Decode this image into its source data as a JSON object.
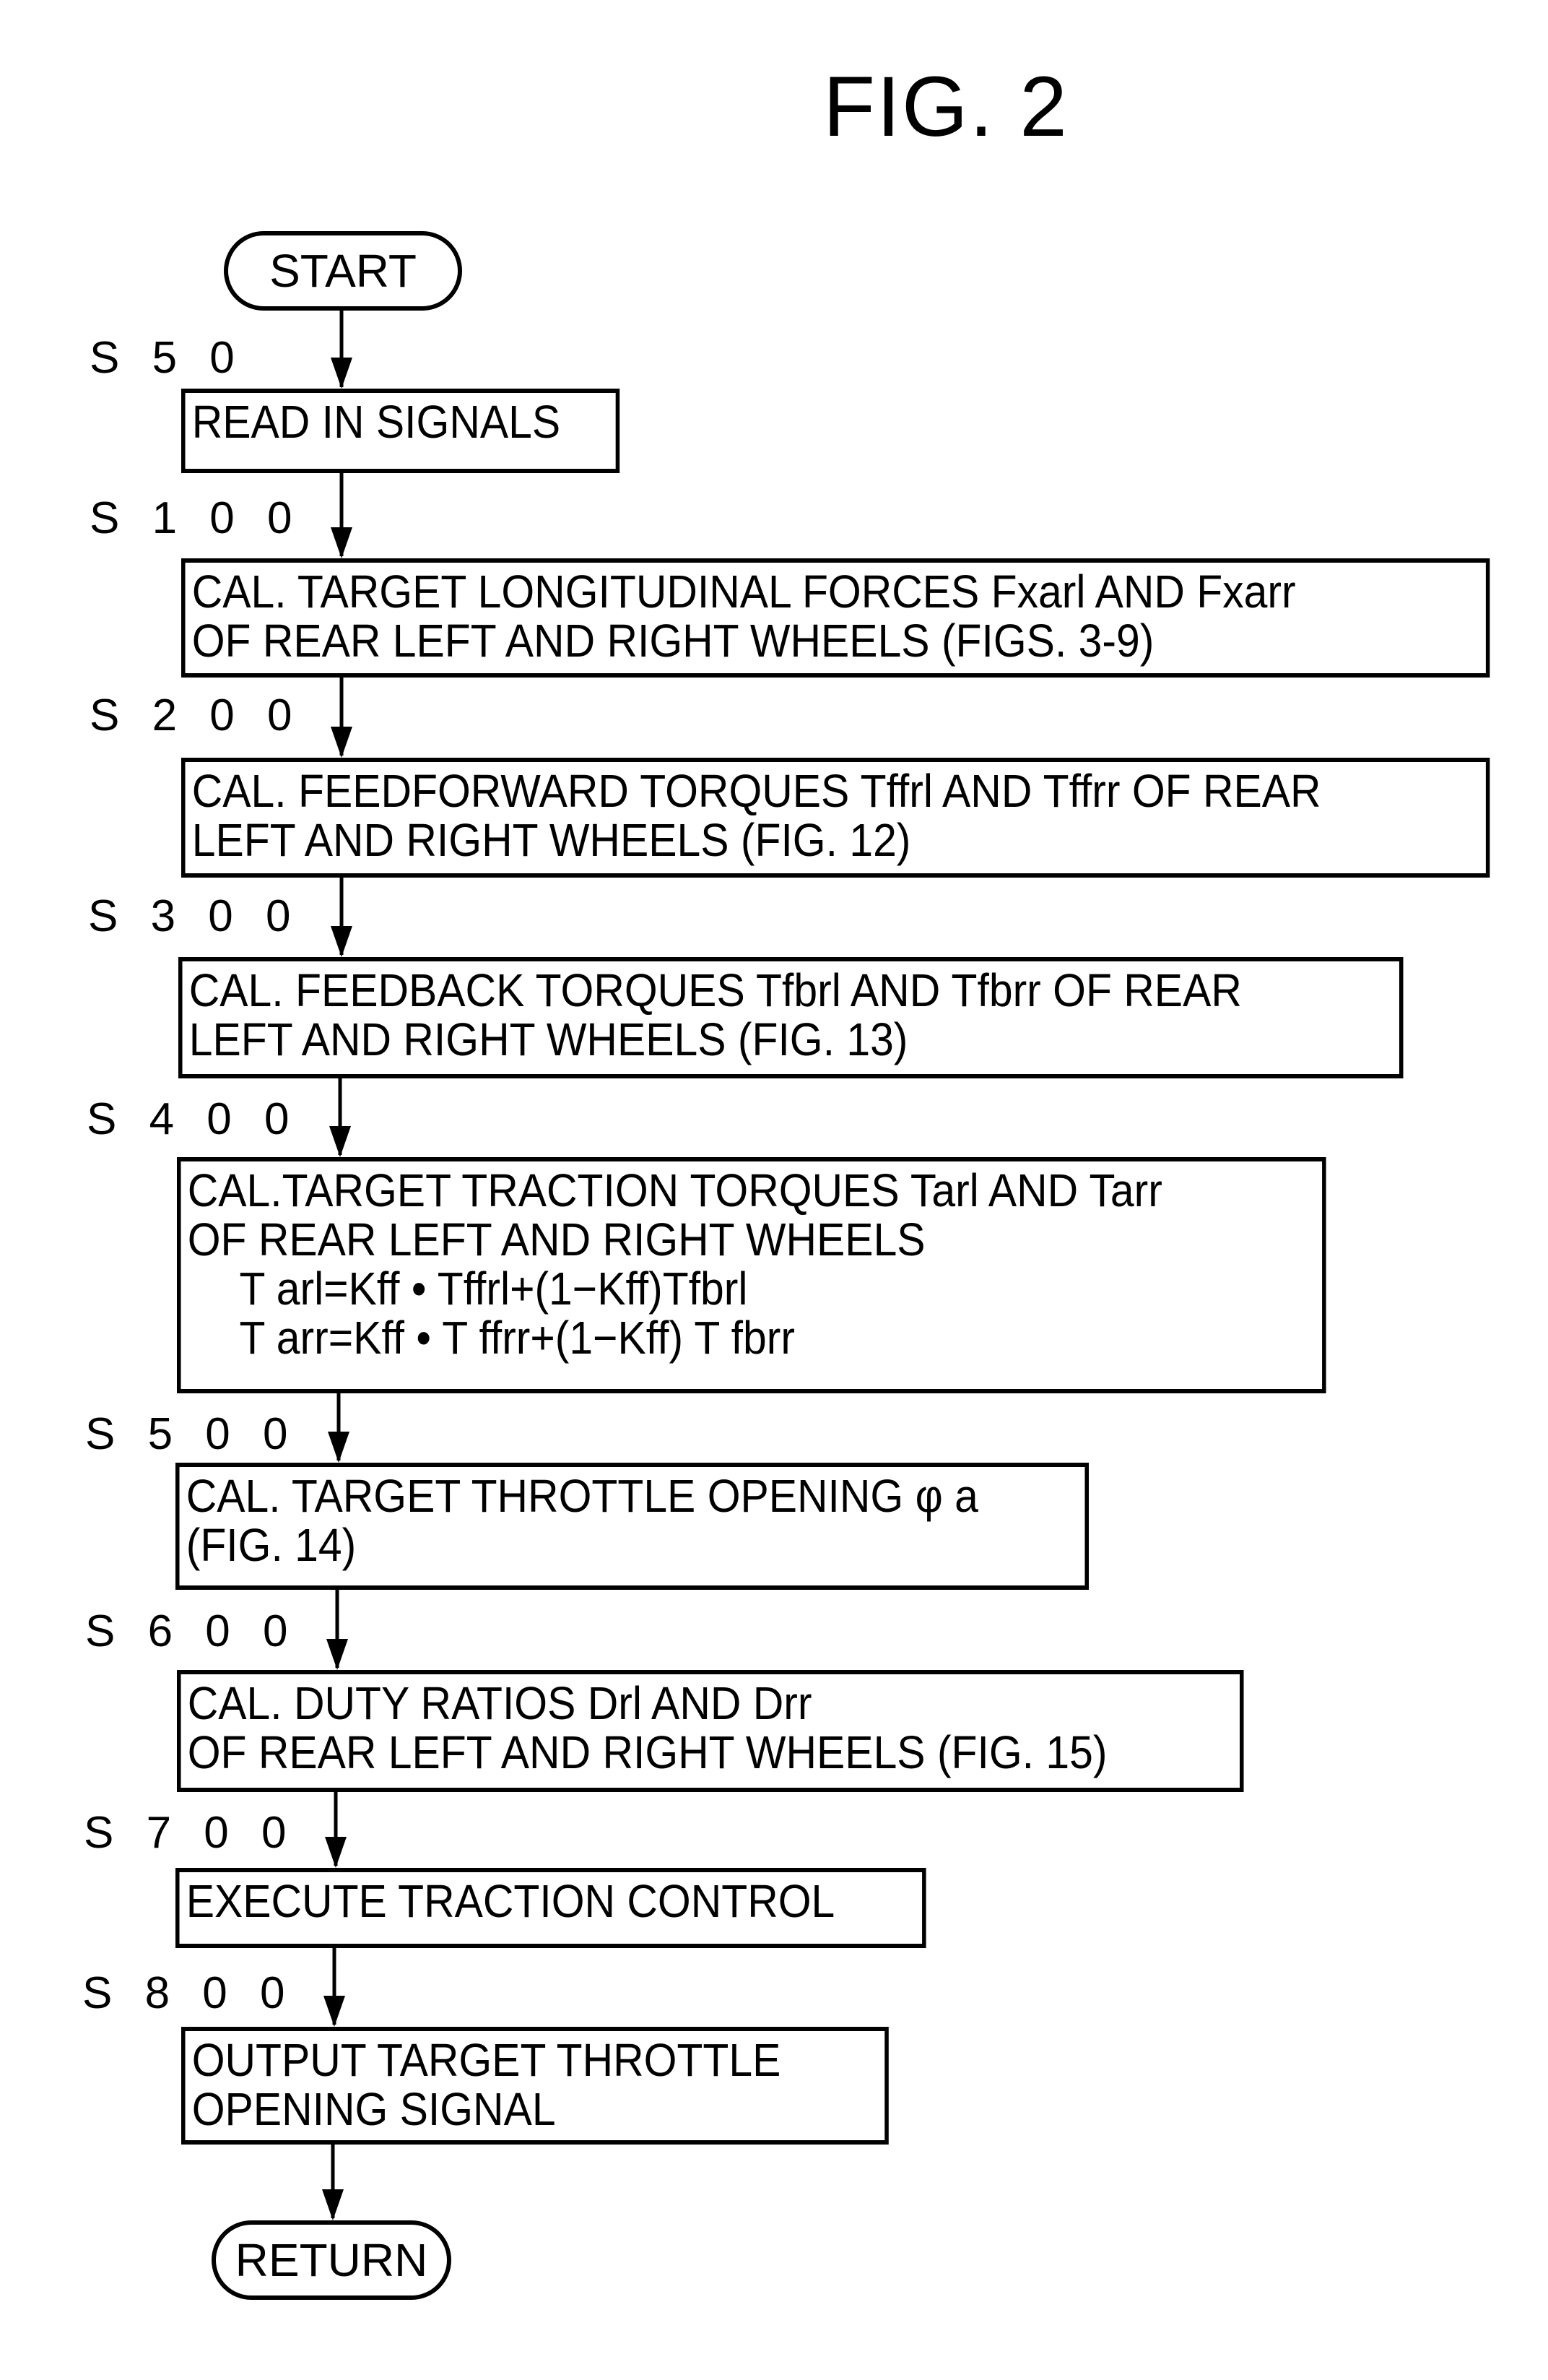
{
  "figure": {
    "title": "FIG. 2",
    "start_label": "START",
    "end_label": "RETURN"
  },
  "steps": [
    {
      "id": "S 5 0",
      "lines": [
        "READ IN SIGNALS"
      ]
    },
    {
      "id": "S 1 0 0",
      "lines": [
        "CAL. TARGET LONGITUDINAL FORCES Fxarl AND Fxarr",
        "OF REAR LEFT AND RIGHT WHEELS (FIGS. 3-9)"
      ]
    },
    {
      "id": "S 2 0 0",
      "lines": [
        "CAL. FEEDFORWARD TORQUES Tffrl AND Tffrr OF REAR",
        "LEFT AND RIGHT WHEELS (FIG. 12)"
      ]
    },
    {
      "id": "S 3 0 0",
      "lines": [
        "CAL. FEEDBACK TORQUES Tfbrl AND Tfbrr OF REAR",
        "LEFT AND RIGHT WHEELS (FIG. 13)"
      ]
    },
    {
      "id": "S 4 0 0",
      "lines": [
        "CAL.TARGET TRACTION TORQUES Tarl AND Tarr",
        "OF REAR LEFT AND RIGHT WHEELS"
      ],
      "formulas": [
        "T arl=Kff • Tffrl+(1−Kff)Tfbrl",
        "T arr=Kff •  T ffrr+(1−Kff) T fbrr"
      ]
    },
    {
      "id": "S 5 0 0",
      "lines": [
        "CAL. TARGET THROTTLE OPENING φ a",
        "(FIG. 14)"
      ]
    },
    {
      "id": "S 6 0 0",
      "lines": [
        "CAL. DUTY RATIOS Drl AND Drr",
        "OF REAR LEFT AND RIGHT WHEELS (FIG. 15)"
      ]
    },
    {
      "id": "S 7 0 0",
      "lines": [
        "EXECUTE TRACTION CONTROL"
      ]
    },
    {
      "id": "S 8 0 0",
      "lines": [
        "OUTPUT TARGET THROTTLE",
        "OPENING SIGNAL"
      ]
    }
  ]
}
